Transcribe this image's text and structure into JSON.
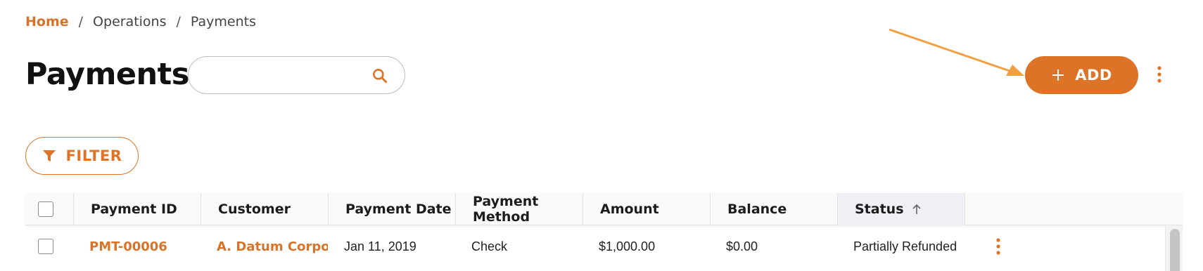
{
  "breadcrumb": {
    "home": "Home",
    "items": [
      "Operations",
      "Payments"
    ],
    "separator": "/"
  },
  "page": {
    "title": "Payments"
  },
  "search": {
    "value": "",
    "placeholder": ""
  },
  "toolbar": {
    "add_label": "ADD",
    "filter_label": "FILTER"
  },
  "icons": {
    "search": "search-icon",
    "add": "plus-icon",
    "more": "more-vertical-icon",
    "filter": "filter-icon",
    "sort": "arrow-up-icon"
  },
  "colors": {
    "accent": "#dd7327",
    "annotation": "#f0a040"
  },
  "table": {
    "columns": [
      "Payment ID",
      "Customer",
      "Payment Date",
      "Payment Method",
      "Amount",
      "Balance",
      "Status"
    ],
    "sorted_column": "Status",
    "sort_direction": "ascending",
    "rows": [
      {
        "payment_id": "PMT-00006",
        "customer": "A. Datum Corporat",
        "payment_date": "Jan 11, 2019",
        "payment_method": "Check",
        "amount": "$1,000.00",
        "balance": "$0.00",
        "status": "Partially Refunded"
      }
    ]
  }
}
